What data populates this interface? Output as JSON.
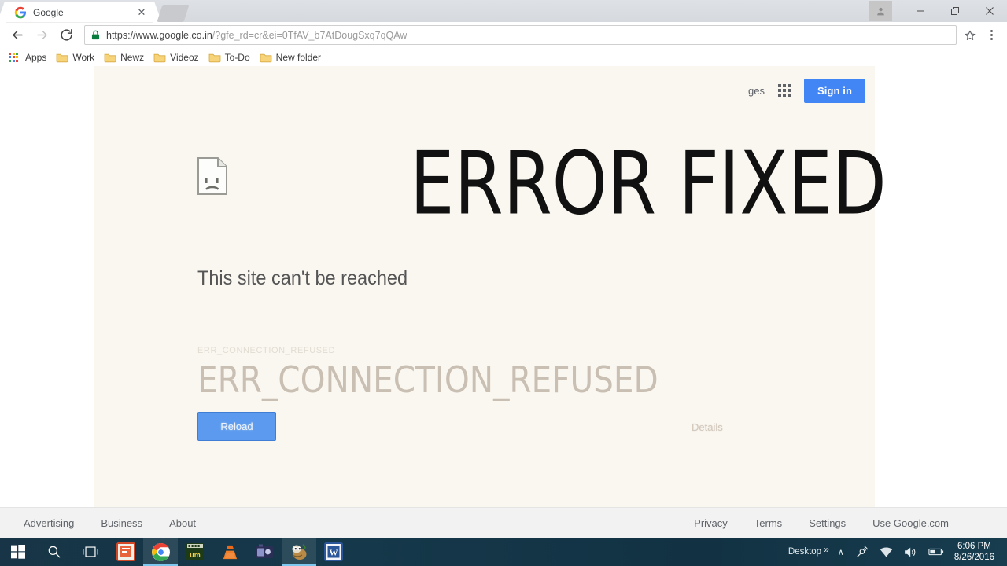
{
  "browser": {
    "tab": {
      "title": "Google",
      "favicon": "google-g-icon",
      "close": "✕"
    },
    "newtab_label": "",
    "window_controls": {
      "profile": "profile-avatar",
      "minimize": "—",
      "maximize": "❐",
      "close": "✕"
    },
    "nav": {
      "back": "←",
      "forward": "→",
      "reload": "↻"
    },
    "omnibox": {
      "secure_icon": "lock-icon",
      "url_base": "https://www.google.co.in",
      "url_query": "/?gfe_rd=cr&ei=0TfAV_b7AtDougSxq7qQAw",
      "full_url": "https://www.google.co.in/?gfe_rd=cr&ei=0TfAV_b7AtDougSxq7qQAw",
      "star_icon": "star-outline-icon",
      "menu_icon": "three-dot-menu-icon"
    },
    "bookmarks": [
      {
        "label": "Apps",
        "icon": "apps-grid-icon"
      },
      {
        "label": "Work",
        "icon": "folder-icon"
      },
      {
        "label": "Newz",
        "icon": "folder-icon"
      },
      {
        "label": "Videoz",
        "icon": "folder-icon"
      },
      {
        "label": "To-Do",
        "icon": "folder-icon"
      },
      {
        "label": "New folder",
        "icon": "folder-icon"
      }
    ]
  },
  "page": {
    "header": {
      "images_link": "ges",
      "apps_icon": "google-apps-grid-icon",
      "signin_label": "Sign in",
      "signin_color": "#4285f4"
    },
    "error": {
      "icon": "sad-page-icon",
      "annotation_title": "ERROR FIXED",
      "heading": "This site can't be reached",
      "code_small": "ERR_CONNECTION_REFUSED",
      "code_large": "ERR_CONNECTION_REFUSED",
      "reload_label": "Reload",
      "reload_color": "#5b9aee",
      "details_label": "Details"
    },
    "footer": {
      "left": [
        "Advertising",
        "Business",
        "About"
      ],
      "right": [
        "Privacy",
        "Terms",
        "Settings",
        "Use Google.com"
      ]
    }
  },
  "taskbar": {
    "start": "windows-start-icon",
    "search": "search-icon",
    "taskview": "task-view-icon",
    "apps": [
      {
        "name": "powerpoint-icon"
      },
      {
        "name": "chrome-icon",
        "active": true
      },
      {
        "name": "um-media-icon"
      },
      {
        "name": "vlc-icon"
      },
      {
        "name": "camtasia-icon"
      },
      {
        "name": "gimp-icon",
        "active": true
      },
      {
        "name": "word-icon"
      }
    ],
    "tray": {
      "desktop_label": "Desktop",
      "overflow": "»",
      "show_hidden": "∧",
      "icons": [
        "satellite-icon",
        "wifi-icon",
        "volume-icon",
        "battery-icon"
      ],
      "time": "6:06 PM",
      "date": "8/26/2016"
    }
  }
}
